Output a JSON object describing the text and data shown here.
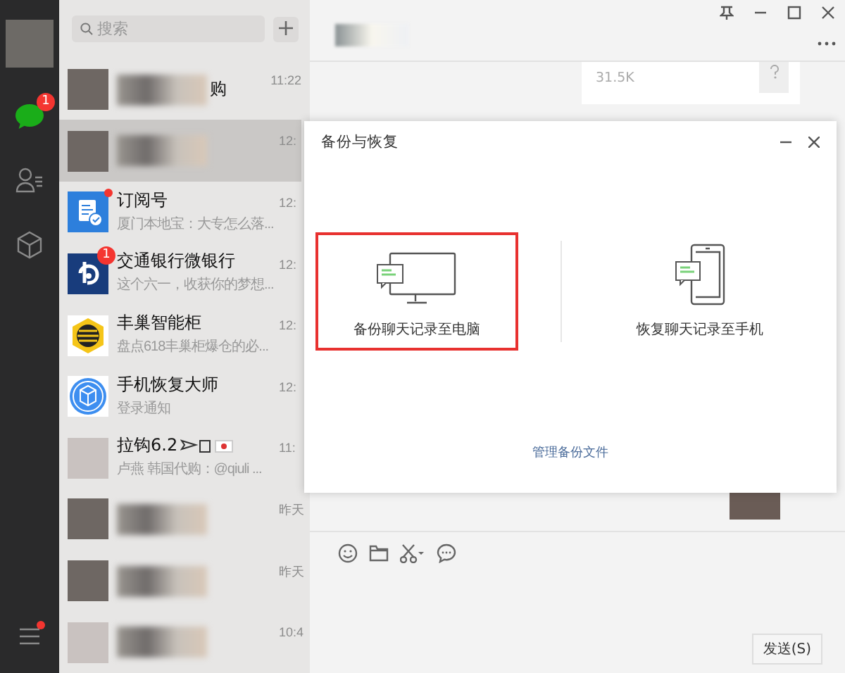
{
  "sidebar": {
    "items": [
      {
        "kind": "chat",
        "selected": true,
        "badge": "1"
      },
      {
        "kind": "contacts",
        "selected": false
      },
      {
        "kind": "favorites",
        "selected": false
      }
    ],
    "menu_notification": true
  },
  "search": {
    "placeholder": "搜索"
  },
  "chats": [
    {
      "kind": "photo",
      "name": "购",
      "time": "11:22",
      "selected": false,
      "dot": false
    },
    {
      "kind": "photo",
      "time": "12:",
      "selected": true,
      "dot": false
    },
    {
      "kind": "subscription",
      "name": "订阅号",
      "preview": "厦门本地宝：大专怎么落...",
      "time": "12:",
      "selected": false,
      "dot": true
    },
    {
      "kind": "bank",
      "name": "交通银行微银行",
      "preview": "这个六一，收获你的梦想...",
      "time": "12:",
      "selected": false,
      "dot": false,
      "badge": "1"
    },
    {
      "kind": "locker",
      "name": "丰巢智能柜",
      "preview": "盘点618丰巢柜爆仓的必...",
      "time": "12:",
      "selected": false,
      "dot": false
    },
    {
      "kind": "recovery",
      "name": "手机恢复大师",
      "preview": "登录通知",
      "time": "12:",
      "selected": false,
      "dot": false
    },
    {
      "kind": "group",
      "name": "拉钩6.2",
      "preview": "卢燕 韩国代购：@qiuli ...",
      "time": "11:",
      "selected": false,
      "dot": false
    },
    {
      "kind": "photo",
      "time": "昨天",
      "selected": false,
      "dot": false
    },
    {
      "kind": "photo",
      "time": "昨天",
      "selected": false,
      "dot": false
    },
    {
      "kind": "group",
      "time": "10:4",
      "selected": false,
      "dot": false
    }
  ],
  "conversation": {
    "file_size": "31.5K",
    "send_button": "发送(S)"
  },
  "dialog": {
    "title": "备份与恢复",
    "options": [
      {
        "kind": "computer",
        "label": "备份聊天记录至电脑",
        "selected": true
      },
      {
        "kind": "phone",
        "label": "恢复聊天记录至手机",
        "selected": false
      }
    ],
    "link": "管理备份文件"
  }
}
